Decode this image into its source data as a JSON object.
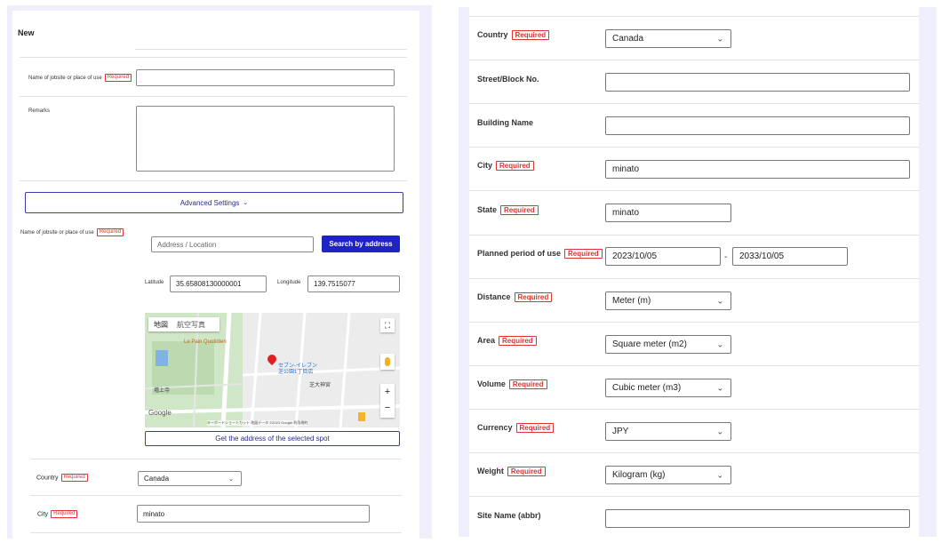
{
  "left": {
    "title": "New",
    "jobsite_label": "Name of jobsite or place of use",
    "required": "Required",
    "remarks_label": "Remarks",
    "advanced_label": "Advanced Settings",
    "advanced_icon": "chevron-down-icon",
    "address_label": "Name of jobsite or place of use",
    "address_placeholder": "Address / Location",
    "search_button": "Search by address",
    "latitude_label": "Latitude",
    "latitude_value": "35.65808130000001",
    "longitude_label": "Longitude",
    "longitude_value": "139.7515077",
    "map": {
      "tab_map": "地図",
      "tab_satellite": "航空写真",
      "place_1": "Le Pain Quotidien",
      "place_2": "セブン-イレブン",
      "place_3": "芝公園1丁目店",
      "place_4": "芝大神宮",
      "place_5": "増上寺",
      "google": "Google",
      "attribution": "キーボードショートカット  地図データ ©2023 Google  利用規約",
      "zoom_in": "+",
      "zoom_out": "−"
    },
    "get_address_button": "Get the address of the selected spot",
    "country_label": "Country",
    "country_value": "Canada",
    "city_label": "City",
    "city_value": "minato"
  },
  "right": {
    "required": "Required",
    "country_label": "Country",
    "country_value": "Canada",
    "street_label": "Street/Block No.",
    "building_label": "Building Name",
    "city_label": "City",
    "city_value": "minato",
    "state_label": "State",
    "state_value": "minato",
    "period_label": "Planned period of use",
    "period_start": "2023/10/05",
    "period_sep": "-",
    "period_end": "2033/10/05",
    "distance_label": "Distance",
    "distance_value": "Meter (m)",
    "area_label": "Area",
    "area_value": "Square meter (m2)",
    "volume_label": "Volume",
    "volume_value": "Cubic meter (m3)",
    "currency_label": "Currency",
    "currency_value": "JPY",
    "weight_label": "Weight",
    "weight_value": "Kilogram (kg)",
    "site_name_label": "Site Name (abbr)"
  }
}
